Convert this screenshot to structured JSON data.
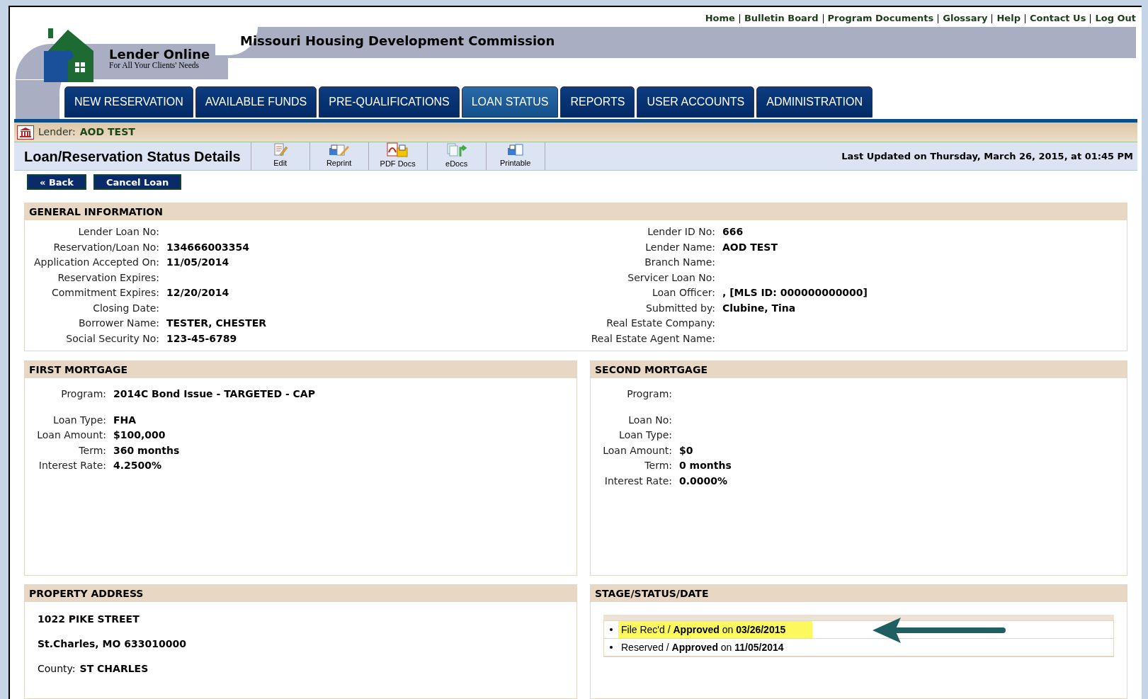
{
  "top_links": [
    "Home",
    "Bulletin Board",
    "Program Documents",
    "Glossary",
    "Help",
    "Contact Us",
    "Log Out"
  ],
  "header": {
    "organization": "Missouri Housing Development Commission",
    "logo_title": "Lender Online",
    "logo_tagline": "For All Your Clients' Needs"
  },
  "tabs": [
    {
      "label": "NEW RESERVATION",
      "selected": false
    },
    {
      "label": "AVAILABLE FUNDS",
      "selected": false
    },
    {
      "label": "PRE-QUALIFICATIONS",
      "selected": false
    },
    {
      "label": "LOAN STATUS",
      "selected": true
    },
    {
      "label": "REPORTS",
      "selected": false
    },
    {
      "label": "USER ACCOUNTS",
      "selected": false
    },
    {
      "label": "ADMINISTRATION",
      "selected": false
    }
  ],
  "lender_bar": {
    "label": "Lender:",
    "value": "AOD TEST"
  },
  "page_title": "Loan/Reservation Status Details",
  "toolbar": [
    {
      "kind": "edit",
      "label": "Edit"
    },
    {
      "kind": "reprint",
      "label": "Reprint"
    },
    {
      "kind": "pdf",
      "label": "PDF Docs"
    },
    {
      "kind": "edocs",
      "label": "eDocs"
    },
    {
      "kind": "printable",
      "label": "Printable"
    }
  ],
  "last_updated": "Last Updated on Thursday, March 26, 2015, at 01:45 PM",
  "buttons": [
    "« Back",
    "Cancel Loan"
  ],
  "general_information": {
    "title": "GENERAL INFORMATION",
    "left": [
      {
        "label": "Lender Loan No:"
      },
      {
        "label": "Reservation/Loan No:",
        "value": "134666003354"
      },
      {
        "label": "Application Accepted On:",
        "value": "11/05/2014"
      },
      {
        "label": "Reservation Expires:"
      },
      {
        "label": "Commitment Expires:",
        "value": "12/20/2014"
      },
      {
        "label": "Closing Date:"
      },
      {
        "label": "Borrower Name:",
        "value": "TESTER, CHESTER"
      },
      {
        "label": "Social Security No:",
        "value": "123-45-6789"
      }
    ],
    "right": [
      {
        "label": "Lender ID No:",
        "value": "666"
      },
      {
        "label": "Lender Name:",
        "value": "AOD TEST"
      },
      {
        "label": "Branch Name:"
      },
      {
        "label": "Servicer Loan No:"
      },
      {
        "label": "Loan Officer:",
        "value": ", [MLS ID: 000000000000]"
      },
      {
        "label": "Submitted by:",
        "value": "Clubine, Tina"
      },
      {
        "label": "Real Estate Company:"
      },
      {
        "label": "Real Estate Agent Name:"
      }
    ]
  },
  "first_mortgage": {
    "title": "FIRST MORTGAGE",
    "fields": [
      {
        "label": "Program:",
        "value": "2014C Bond Issue - TARGETED - CAP"
      },
      {
        "label": "Loan Type:",
        "value": "FHA"
      },
      {
        "label": "Loan Amount:",
        "value": "$100,000"
      },
      {
        "label": "Term:",
        "value": "360 months"
      },
      {
        "label": "Interest Rate:",
        "value": "4.2500%"
      }
    ]
  },
  "second_mortgage": {
    "title": "SECOND MORTGAGE",
    "fields": [
      {
        "label": "Program:"
      },
      {
        "label": "Loan No:"
      },
      {
        "label": "Loan Type:"
      },
      {
        "label": "Loan Amount:",
        "value": "$0"
      },
      {
        "label": "Term:",
        "value": "0 months"
      },
      {
        "label": "Interest Rate:",
        "value": "0.0000%"
      }
    ]
  },
  "property_address": {
    "title": "PROPERTY ADDRESS",
    "street": "1022 PIKE STREET",
    "city": "St.Charles, MO 633010000",
    "county_label": "County:",
    "county": "ST CHARLES"
  },
  "stage_status": {
    "title": "STAGE/STATUS/DATE",
    "items": [
      {
        "text": "File Rec'd / **Approved** on **03/26/2015**",
        "highlighted": true
      },
      {
        "text": "Reserved / **Approved** on **11/05/2014**",
        "highlighted": false
      }
    ]
  }
}
